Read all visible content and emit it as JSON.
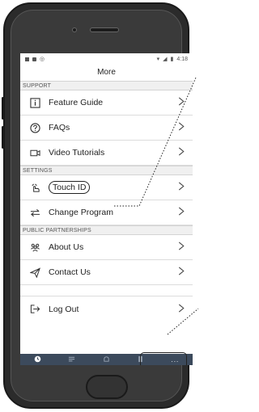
{
  "status_bar": {
    "time": "4:18"
  },
  "header": {
    "title": "More"
  },
  "sections": [
    {
      "title": "SUPPORT",
      "items": [
        {
          "label": "Feature Guide",
          "icon": "info-box-icon"
        },
        {
          "label": "FAQs",
          "icon": "question-circle-icon"
        },
        {
          "label": "Video Tutorials",
          "icon": "video-camera-icon"
        }
      ]
    },
    {
      "title": "SETTINGS",
      "items": [
        {
          "label": "Touch ID",
          "icon": "hand-pointer-icon"
        },
        {
          "label": "Change Program",
          "icon": "swap-arrows-icon"
        }
      ]
    },
    {
      "title": "PUBLIC PARTNERSHIPS",
      "items": [
        {
          "label": "About Us",
          "icon": "people-icon"
        },
        {
          "label": "Contact Us",
          "icon": "paper-plane-icon"
        }
      ]
    }
  ],
  "logout": {
    "label": "Log Out",
    "icon": "logout-arrow-icon"
  },
  "tab_bar": {
    "tabs": [
      {
        "icon": "clock-icon"
      },
      {
        "icon": "list-icon"
      },
      {
        "icon": "bell-icon"
      },
      {
        "icon": "document-icon"
      },
      {
        "label": "..."
      }
    ],
    "colors": {
      "background": "#3c4a5c"
    }
  }
}
